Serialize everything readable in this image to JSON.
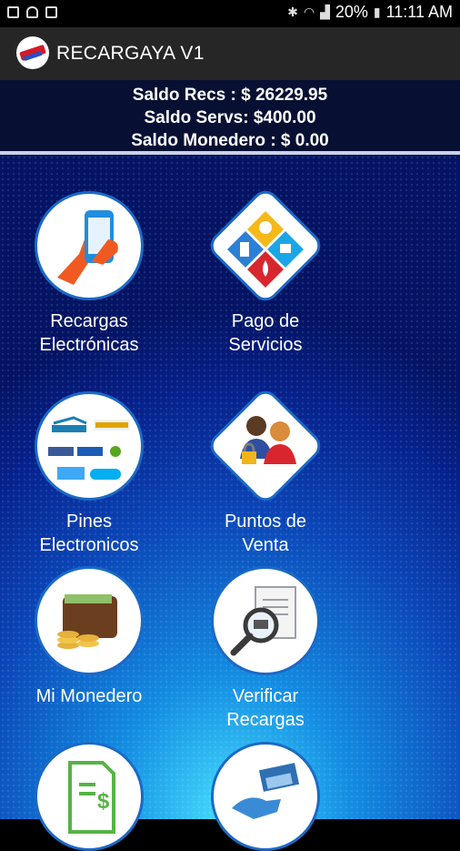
{
  "status_bar": {
    "battery": "20%",
    "time": "11:11 AM"
  },
  "app_bar": {
    "title": "RECARGAYA V1"
  },
  "balances": {
    "recargas": "Saldo Recs : $ 26229.95",
    "servicios": "Saldo Servs: $400.00",
    "monedero": "Saldo Monedero : $ 0.00"
  },
  "menu": {
    "items": [
      {
        "label_line1": "Recargas",
        "label_line2": "Electrónicas",
        "icon": "phone-hand-icon"
      },
      {
        "label_line1": "Pago de",
        "label_line2": "Servicios",
        "icon": "services-diamond-icon"
      },
      {
        "label_line1": "Pines",
        "label_line2": "Electronicos",
        "icon": "pins-brands-icon"
      },
      {
        "label_line1": "Puntos de",
        "label_line2": "Venta",
        "icon": "sales-points-icon"
      },
      {
        "label_line1": "Mi Monedero",
        "label_line2": "",
        "icon": "wallet-icon"
      },
      {
        "label_line1": "Verificar",
        "label_line2": "Recargas",
        "icon": "verify-search-icon"
      },
      {
        "label_line1": "",
        "label_line2": "",
        "icon": "invoice-dollar-icon"
      },
      {
        "label_line1": "",
        "label_line2": "",
        "icon": "money-handshake-icon"
      }
    ]
  },
  "colors": {
    "accent": "#1b69c6",
    "header_bg": "#262626",
    "balance_bg": "#071033"
  }
}
